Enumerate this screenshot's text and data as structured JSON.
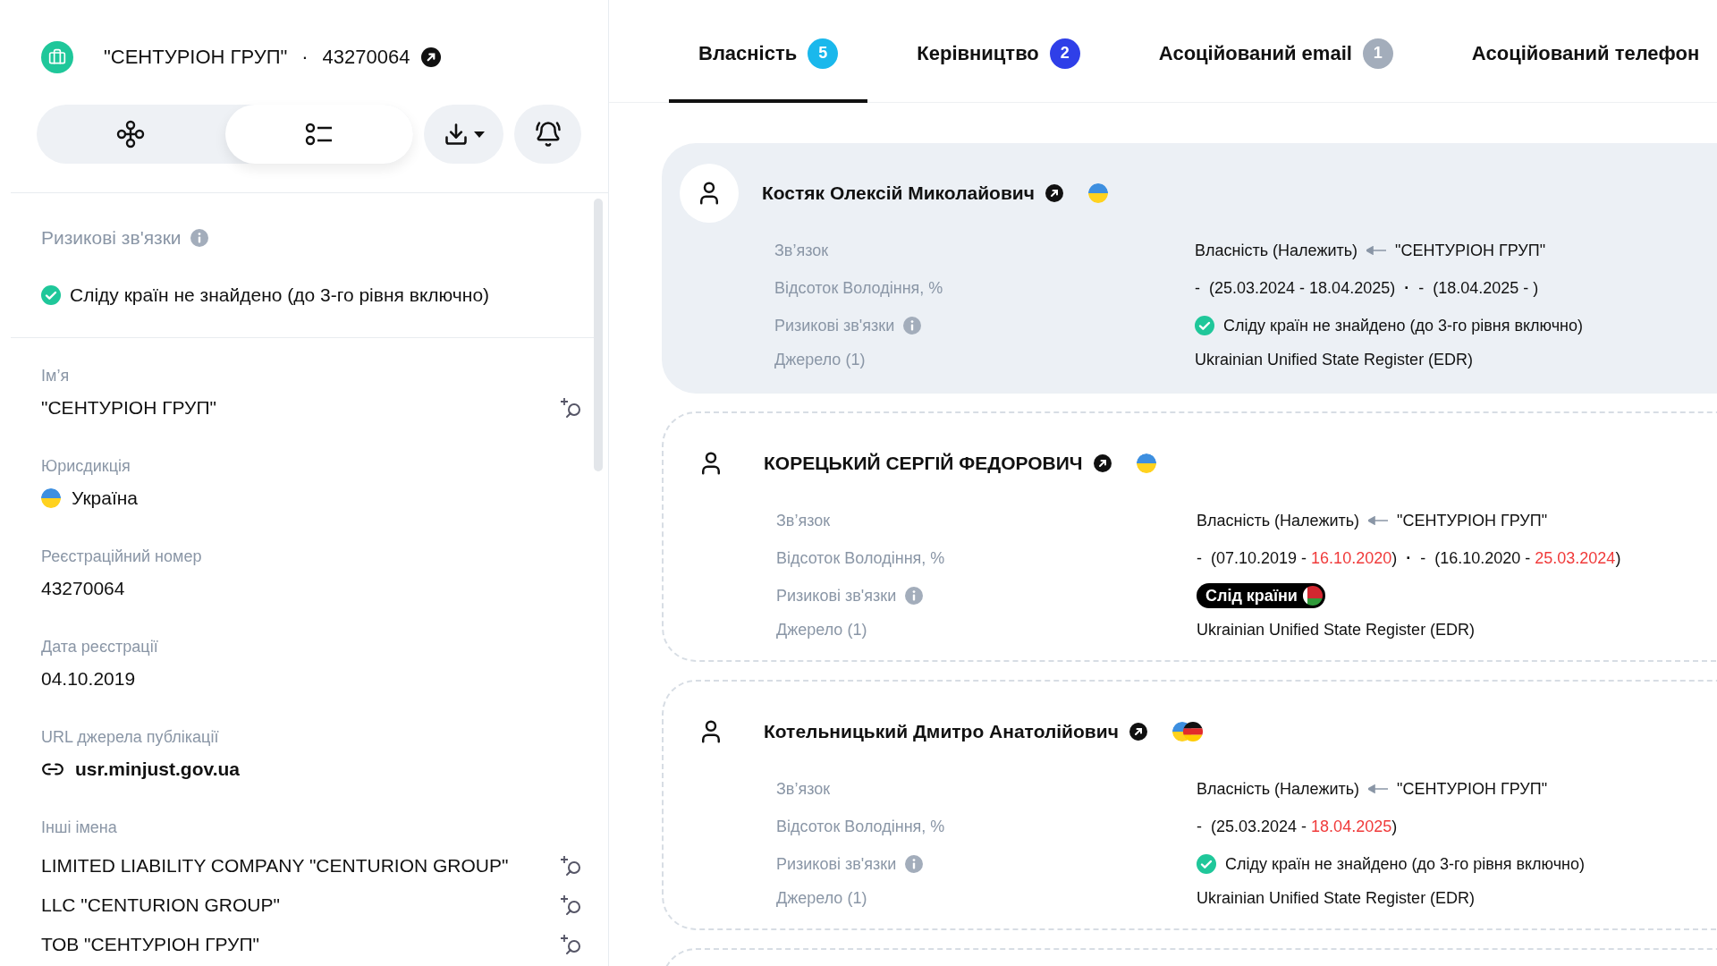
{
  "entity": {
    "title": "\"СЕНТУРІОН ГРУП\"",
    "separator": "·",
    "code": "43270064"
  },
  "view_toggle": [
    {
      "kind": "graph",
      "selected": false
    },
    {
      "kind": "list",
      "selected": true
    }
  ],
  "risk": {
    "label": "Ризикові зв'язки",
    "status": {
      "kind": "clear",
      "text": "Сліду країн не знайдено (до 3-го рівня включно)"
    }
  },
  "fields": [
    {
      "kind": "name",
      "label": "Ім’я",
      "value": "\"СЕНТУРІОН ГРУП\""
    },
    {
      "kind": "country",
      "label": "Юрисдикція",
      "value": "Україна",
      "flag": {
        "kind": "ua"
      }
    },
    {
      "kind": "plain",
      "label": "Реєстраційний номер",
      "value": "43270064"
    },
    {
      "kind": "plain",
      "label": "Дата реєстрації",
      "value": "04.10.2019"
    },
    {
      "kind": "link",
      "label": "URL джерела публікації",
      "value": "usr.minjust.gov.ua"
    }
  ],
  "other_names": {
    "label": "Інші імена",
    "items": [
      "LIMITED LIABILITY COMPANY \"CENTURION GROUP\"",
      "LLC \"CENTURION GROUP\"",
      "ТОВ \"СЕНТУРІОН ГРУП\""
    ]
  },
  "tabs": [
    {
      "label": "Власність",
      "count": "5",
      "color": "#1ab8ec",
      "selected": true
    },
    {
      "label": "Керівництво",
      "count": "2",
      "color": "#2f3fe8",
      "selected": false
    },
    {
      "label": "Асоційований email",
      "count": "1",
      "color": "#a3adbb",
      "selected": false
    },
    {
      "label": "Асоційований телефон",
      "selected": false
    }
  ],
  "cards": [
    {
      "highlighted": true,
      "name": "Костяк Олексій Миколайович",
      "flags": [
        {
          "kind": "ua"
        }
      ],
      "relation": {
        "label": "Зв’язок",
        "value": "Власність (Належить)",
        "target": "\"СЕНТУРІОН ГРУП\""
      },
      "ownership": {
        "label": "Відсоток Володіння, %",
        "separator": "·",
        "periods": [
          {
            "share": "-",
            "parts": [
              {
                "text": "(25.03.2024 - ",
                "alert": false
              },
              {
                "text": "18.04.2025",
                "alert": false
              },
              {
                "text": ")",
                "alert": false
              }
            ]
          },
          {
            "share": "-",
            "parts": [
              {
                "text": "(18.04.2025 - )",
                "alert": false
              }
            ]
          }
        ]
      },
      "risk": {
        "label": "Ризикові зв'язки",
        "kind": "clear",
        "text": "Сліду країн не знайдено (до 3-го рівня включно)"
      },
      "source": {
        "label": "Джерело (1)",
        "value": "Ukrainian Unified State Register (EDR)"
      }
    },
    {
      "highlighted": false,
      "name": "КОРЕЦЬКИЙ СЕРГІЙ ФЕДОРОВИЧ",
      "flags": [
        {
          "kind": "ua"
        }
      ],
      "relation": {
        "label": "Зв’язок",
        "value": "Власність (Належить)",
        "target": "\"СЕНТУРІОН ГРУП\""
      },
      "ownership": {
        "label": "Відсоток Володіння, %",
        "separator": "·",
        "periods": [
          {
            "share": "-",
            "parts": [
              {
                "text": "(07.10.2019 - ",
                "alert": false
              },
              {
                "text": "16.10.2020",
                "alert": true
              },
              {
                "text": ")",
                "alert": false
              }
            ]
          },
          {
            "share": "-",
            "parts": [
              {
                "text": "(16.10.2020 - ",
                "alert": false
              },
              {
                "text": "25.03.2024",
                "alert": true
              },
              {
                "text": ")",
                "alert": false
              }
            ]
          }
        ]
      },
      "risk": {
        "label": "Ризикові зв'язки",
        "kind": "trace",
        "text": "Слід країни",
        "flag": {
          "kind": "by"
        }
      },
      "source": {
        "label": "Джерело (1)",
        "value": "Ukrainian Unified State Register (EDR)"
      }
    },
    {
      "highlighted": false,
      "name": "Котельницький Дмитро Анатолійович",
      "flags": [
        {
          "kind": "ua"
        },
        {
          "kind": "de"
        }
      ],
      "relation": {
        "label": "Зв’язок",
        "value": "Власність (Належить)",
        "target": "\"СЕНТУРІОН ГРУП\""
      },
      "ownership": {
        "label": "Відсоток Володіння, %",
        "periods": [
          {
            "share": "-",
            "parts": [
              {
                "text": "(25.03.2024 - ",
                "alert": false
              },
              {
                "text": "18.04.2025",
                "alert": true
              },
              {
                "text": ")",
                "alert": false
              }
            ]
          }
        ]
      },
      "risk": {
        "label": "Ризикові зв'язки",
        "kind": "clear",
        "text": "Сліду країн не знайдено (до 3-го рівня включно)"
      },
      "source": {
        "label": "Джерело (1)",
        "value": "Ukrainian Unified State Register (EDR)"
      }
    }
  ]
}
